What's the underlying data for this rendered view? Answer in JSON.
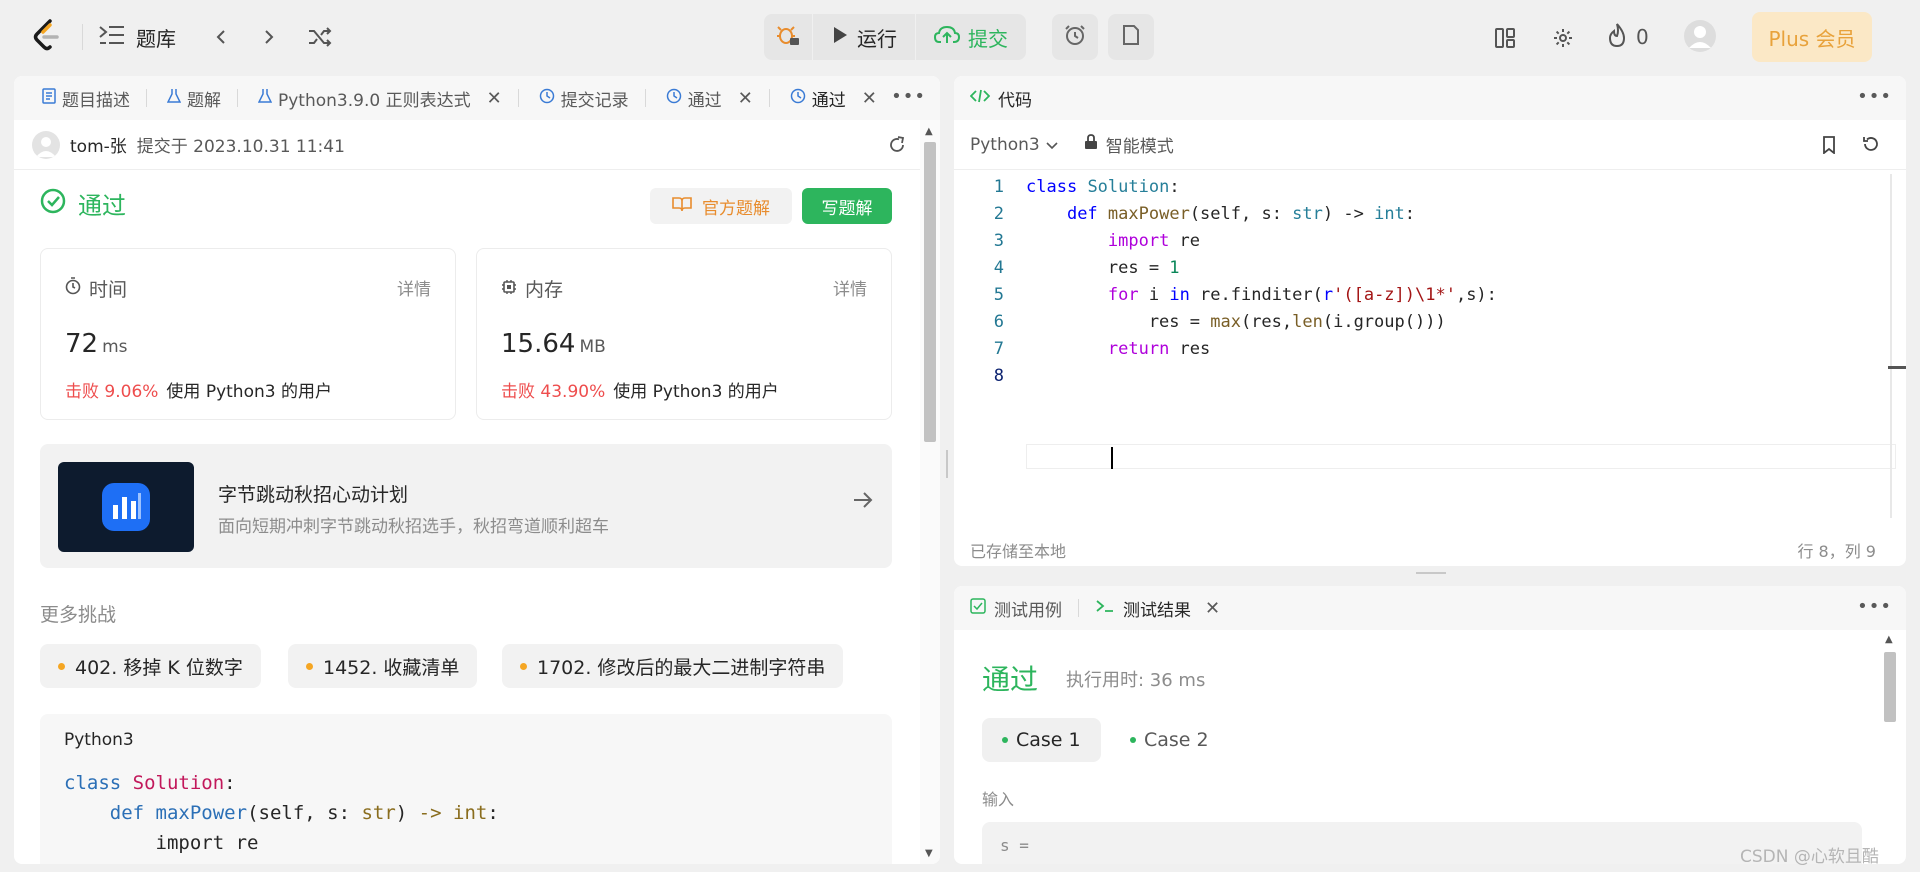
{
  "topbar": {
    "problem_list": "题库",
    "run": "运行",
    "submit": "提交",
    "streak": "0",
    "plus": "Plus 会员"
  },
  "left_tabs": [
    {
      "label": "题目描述",
      "icon": "document-icon"
    },
    {
      "label": "题解",
      "icon": "flask-icon"
    },
    {
      "label": "Python3.9.0 正则表达式",
      "icon": "flask-icon"
    },
    {
      "label": "提交记录",
      "icon": "history-icon"
    },
    {
      "label": "通过",
      "icon": "history-icon"
    },
    {
      "label": "通过",
      "icon": "history-icon"
    }
  ],
  "submission": {
    "user": "tom-张",
    "submitted_at": "提交于 2023.10.31 11:41",
    "status": "通过",
    "official_solution": "官方题解",
    "write_solution": "写题解"
  },
  "stats": {
    "time": {
      "label": "时间",
      "detail": "详情",
      "value": "72",
      "unit": "ms",
      "beat": "击败 9.06%",
      "users": "使用 Python3 的用户"
    },
    "memory": {
      "label": "内存",
      "detail": "详情",
      "value": "15.64",
      "unit": "MB",
      "beat": "击败 43.90%",
      "users": "使用 Python3 的用户"
    }
  },
  "promo": {
    "title": "字节跳动秋招心动计划",
    "subtitle": "面向短期冲刺字节跳动秋招选手，秋招弯道顺利超车"
  },
  "more_challenges": {
    "title": "更多挑战",
    "items": [
      "402. 移掉 K 位数字",
      "1452. 收藏清单",
      "1702. 修改后的最大二进制字符串"
    ]
  },
  "code_preview": {
    "lang": "Python3",
    "line1_kw": "class",
    "line1_cls": "Solution",
    "line2_kw": "def",
    "line2_fn": "maxPower",
    "line3": "import re"
  },
  "editor": {
    "tab": "代码",
    "lang": "Python3",
    "mode": "智能模式",
    "saved": "已存储至本地",
    "cursor": "行 8，列 9",
    "line_numbers": [
      "1",
      "2",
      "3",
      "4",
      "5",
      "6",
      "7",
      "8"
    ]
  },
  "test": {
    "tab_cases": "测试用例",
    "tab_result": "测试结果",
    "status": "通过",
    "runtime": "执行用时: 36 ms",
    "case1": "Case 1",
    "case2": "Case 2",
    "input_label": "输入",
    "input_value": "s ="
  },
  "watermark": "CSDN @心软且酷"
}
